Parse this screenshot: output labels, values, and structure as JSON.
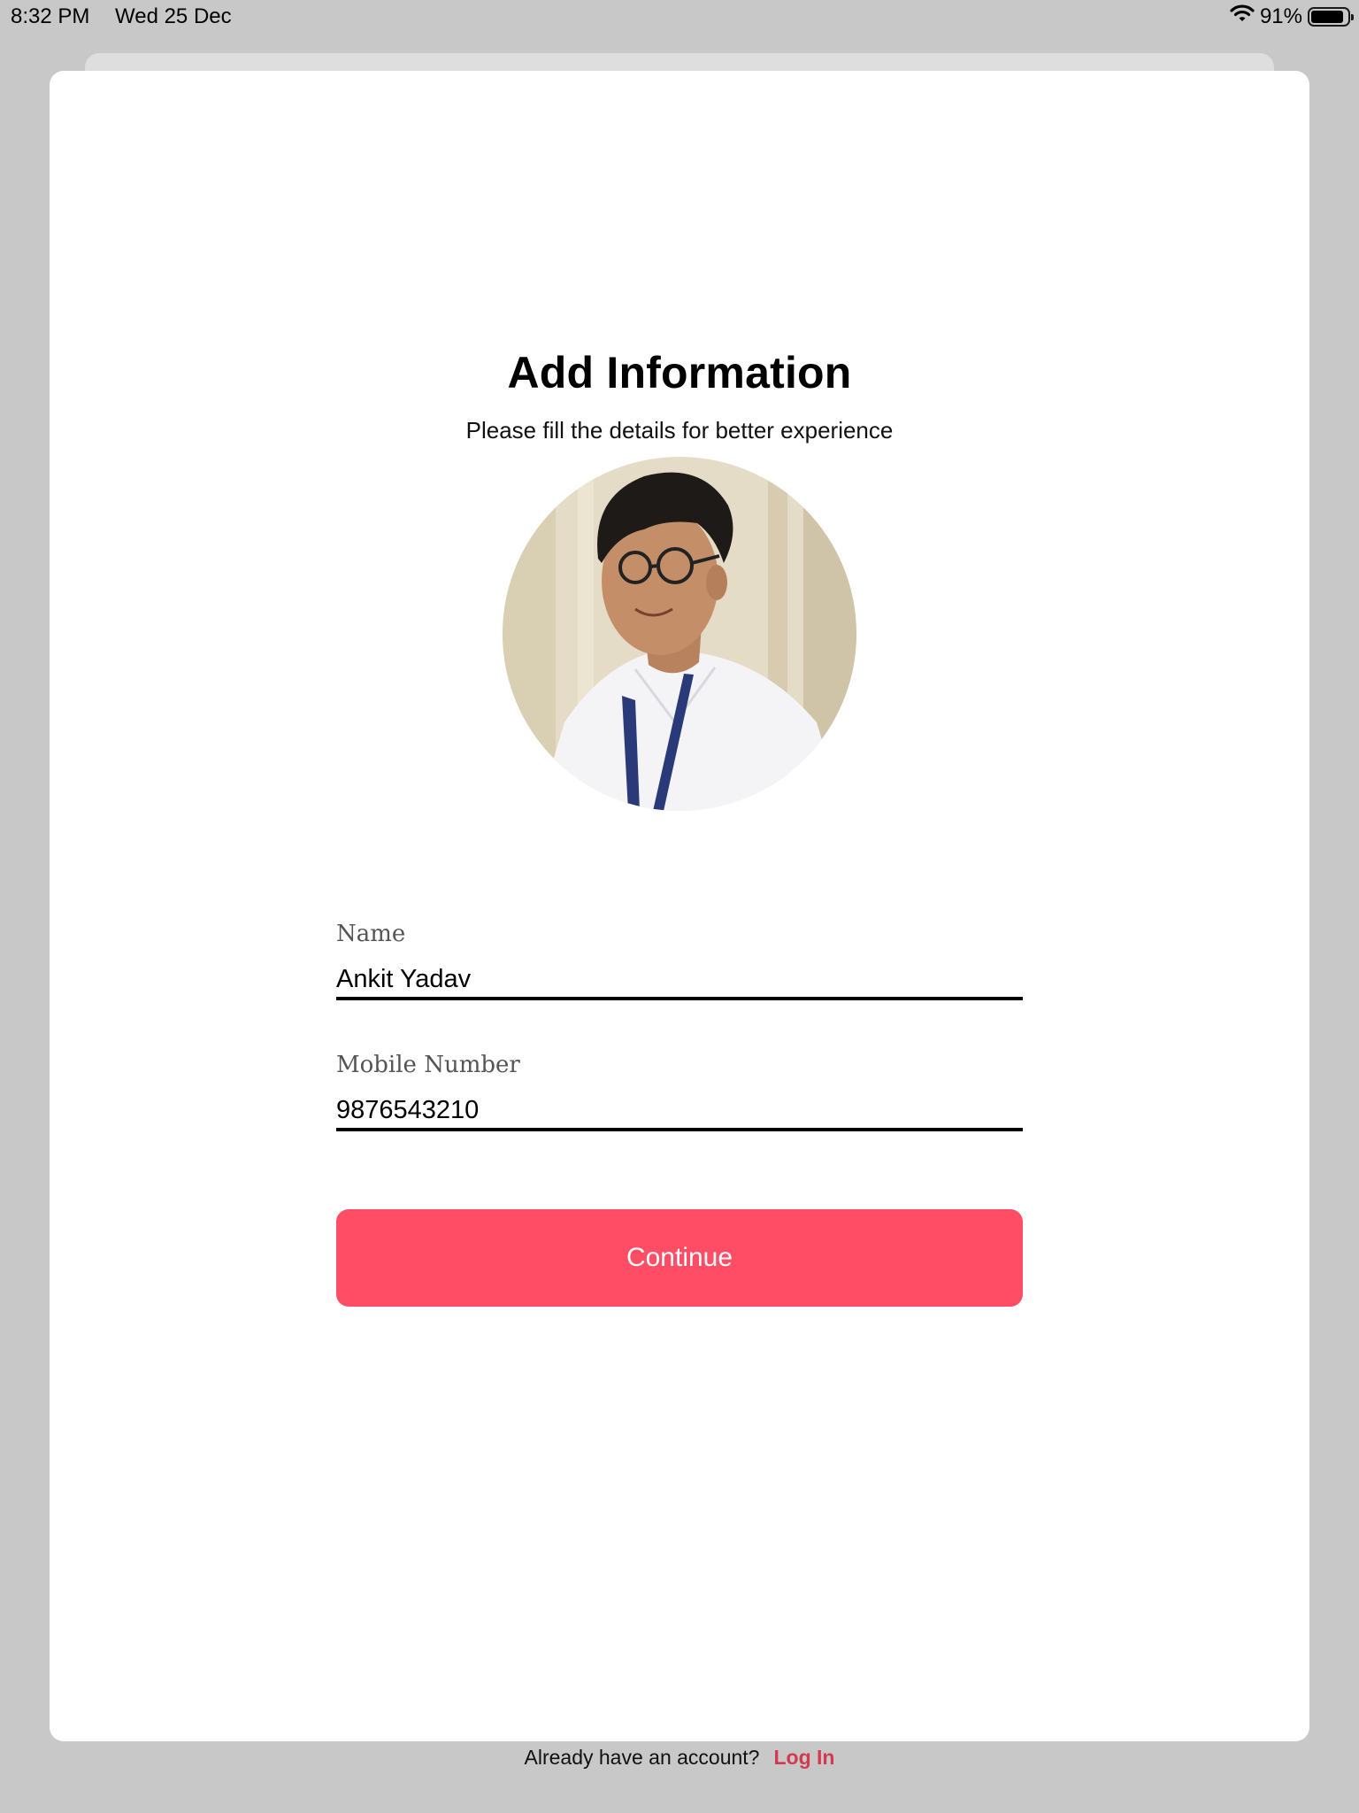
{
  "status_bar": {
    "time": "8:32 PM",
    "date": "Wed 25 Dec",
    "battery": "91%",
    "battery_level": 0.91
  },
  "header": {
    "title": "Add Information",
    "subtitle": "Please fill the details for better experience"
  },
  "form": {
    "name_label": "Name",
    "name_value": "Ankit Yadav",
    "mobile_label": "Mobile Number",
    "mobile_value": "9876543210",
    "continue_label": "Continue"
  },
  "footer": {
    "prompt": "Already have an account?",
    "login_label": "Log In"
  },
  "colors": {
    "accent": "#ff4d66",
    "link": "#d23a52",
    "backdrop": "#c8c8c8"
  }
}
